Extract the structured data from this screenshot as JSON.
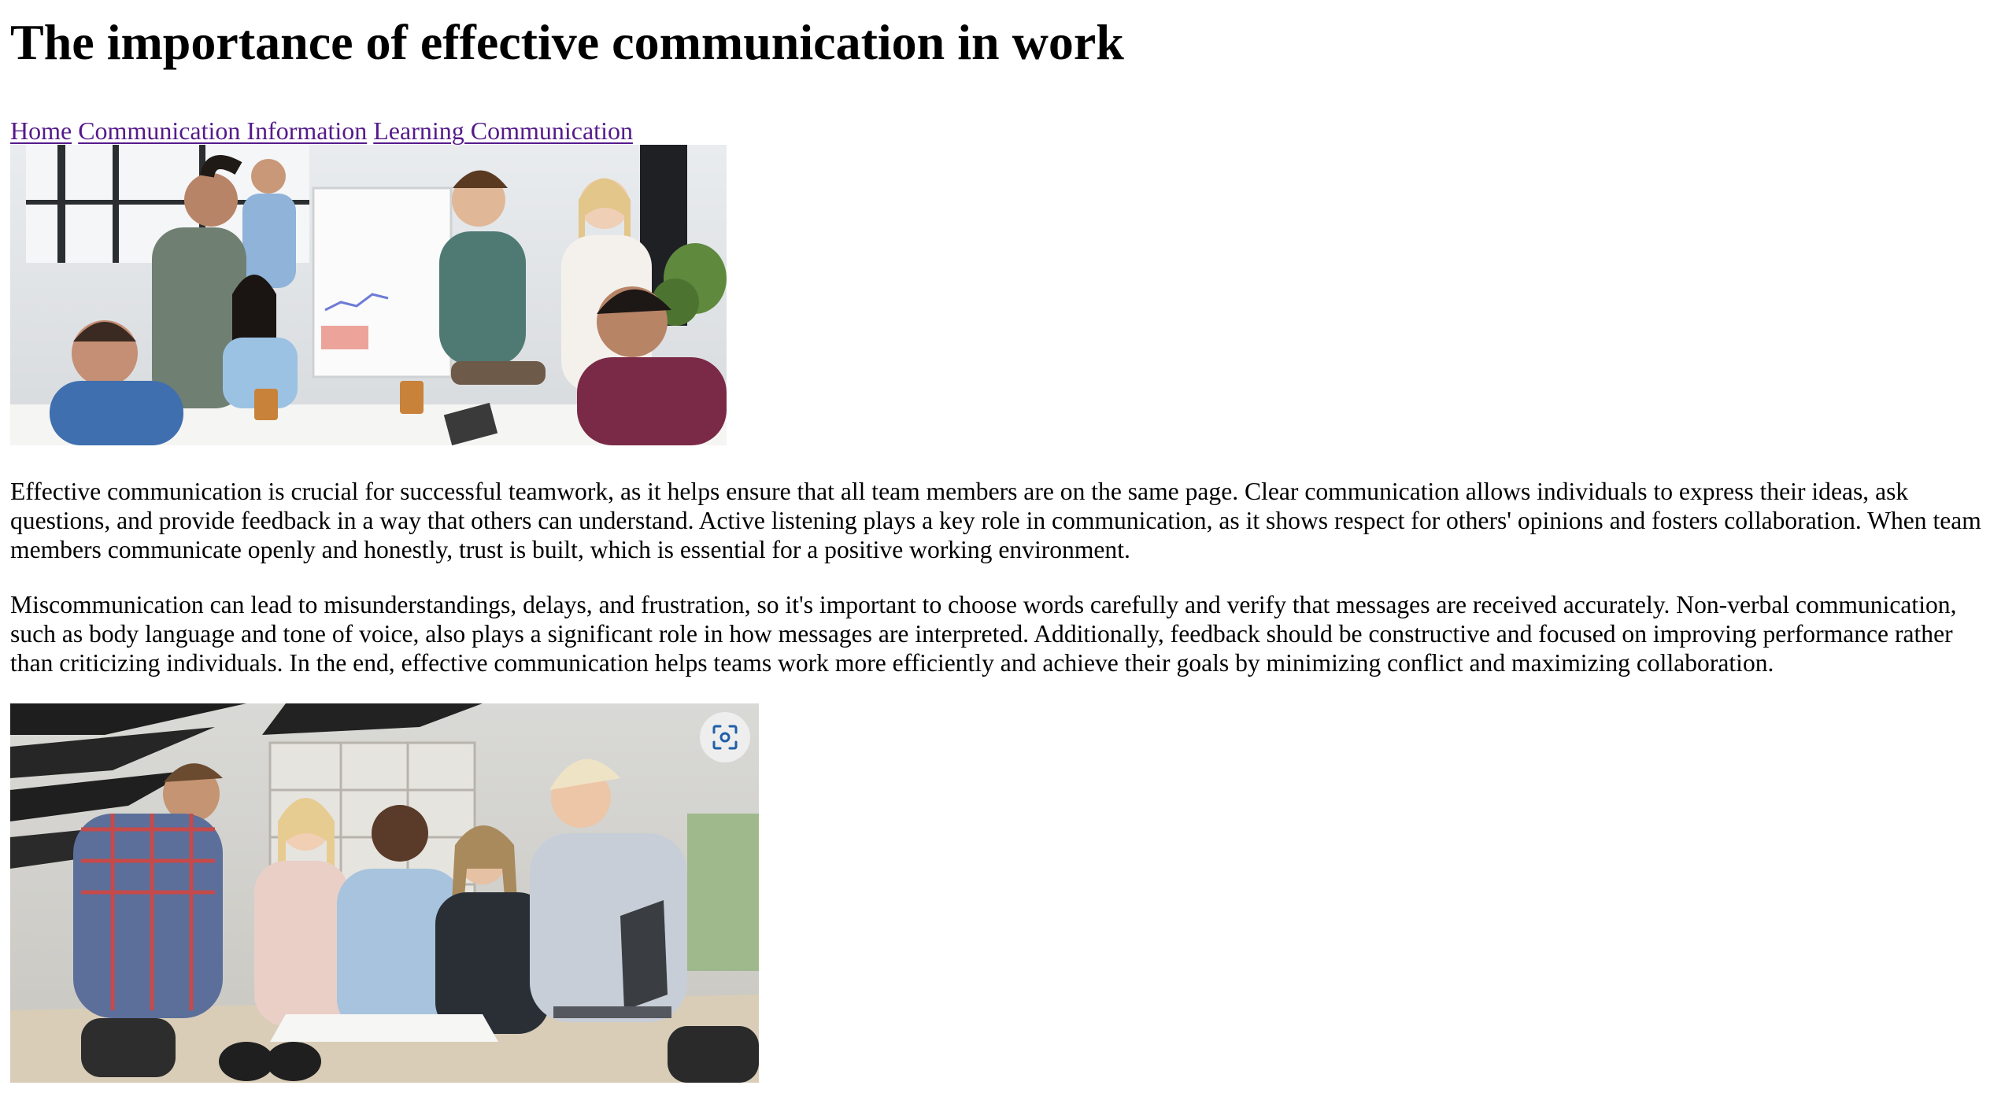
{
  "page": {
    "title": "The importance of effective communication in work"
  },
  "nav": {
    "links": [
      {
        "label": "Home"
      },
      {
        "label": "Communication Information"
      },
      {
        "label": "Learning Communication"
      }
    ],
    "link_color": "#551a8b"
  },
  "content": {
    "paragraph_1": "Effective communication is crucial for successful teamwork, as it helps ensure that all team members are on the same page. Clear communication allows individuals to express their ideas, ask questions, and provide feedback in a way that others can understand. Active listening plays a key role in communication, as it shows respect for others' opinions and fosters collaboration. When team members communicate openly and honestly, trust is built, which is essential for a positive working environment.",
    "paragraph_2": "Miscommunication can lead to misunderstandings, delays, and frustration, so it's important to choose words carefully and verify that messages are received accurately. Non-verbal communication, such as body language and tone of voice, also plays a significant role in how messages are interpreted. Additionally, feedback should be constructive and focused on improving performance rather than criticizing individuals. In the end, effective communication helps teams work more efficiently and achieve their goals by minimizing conflict and maximizing collaboration."
  },
  "images": {
    "photo_1_icon": "team-meeting-photo",
    "photo_2_icon": "team-collaboration-photo",
    "lens_icon": "visual-search-icon"
  }
}
